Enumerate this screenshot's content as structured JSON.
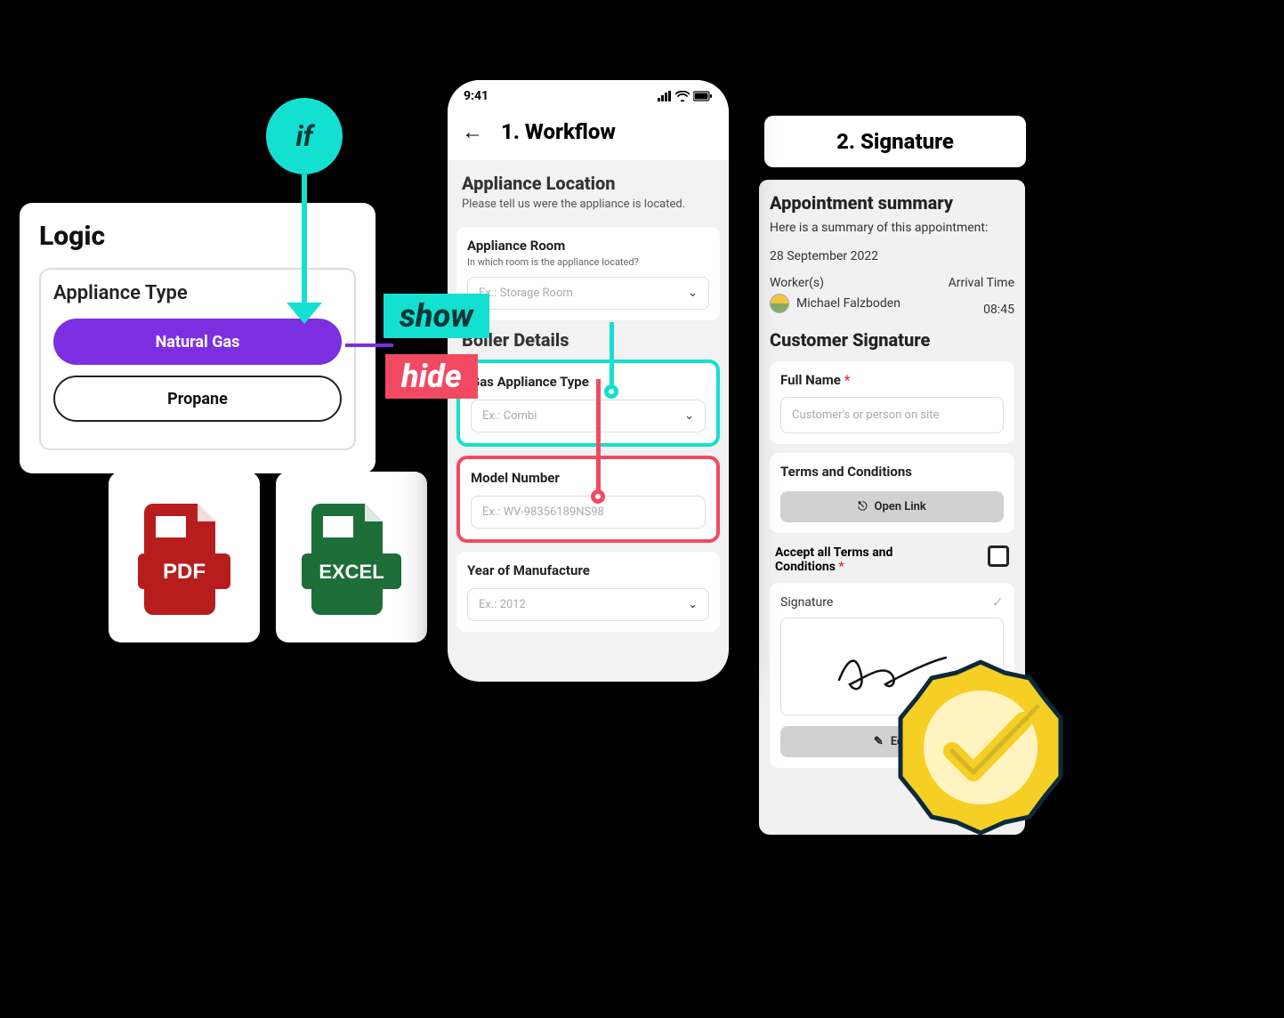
{
  "logic": {
    "title": "Logic",
    "subtitle": "Appliance Type",
    "option_ng": "Natural Gas",
    "option_pr": "Propane"
  },
  "if_label": "if",
  "badge_show": "show",
  "badge_hide": "hide",
  "files": {
    "pdf": "PDF",
    "excel": "EXCEL"
  },
  "phone": {
    "time": "9:41",
    "title": "1. Workflow",
    "section_title": "Appliance Location",
    "section_sub": "Please tell us were the appliance is located.",
    "room": {
      "label": "Appliance Room",
      "help": "In which room is the appliance located?",
      "placeholder": "Ex.: Storage Room"
    },
    "boiler_title": "Boiler Details",
    "gas_type": {
      "label": "Gas Appliance Type",
      "placeholder": "Ex.: Combi"
    },
    "model": {
      "label": "Model Number",
      "placeholder": "Ex.: WV-98356189NS98"
    },
    "year": {
      "label": "Year of Manufacture",
      "placeholder": "Ex.: 2012"
    }
  },
  "sig_tab": "2. Signature",
  "signature": {
    "h1": "Appointment summary",
    "p": "Here is a summary of this appointment:",
    "date": "28 September 2022",
    "workers_label": "Worker(s)",
    "arrival_label": "Arrival Time",
    "worker_name": "Michael Falzboden",
    "arrival_time": "08:45",
    "h2": "Customer Signature",
    "full_name_label": "Full Name",
    "full_name_placeholder": "Customer's or person on site",
    "terms_label": "Terms and Conditions",
    "open_link": "Open Link",
    "accept_label": "Accept all Terms and Conditions",
    "sig_label": "Signature",
    "edit": "Edit"
  }
}
